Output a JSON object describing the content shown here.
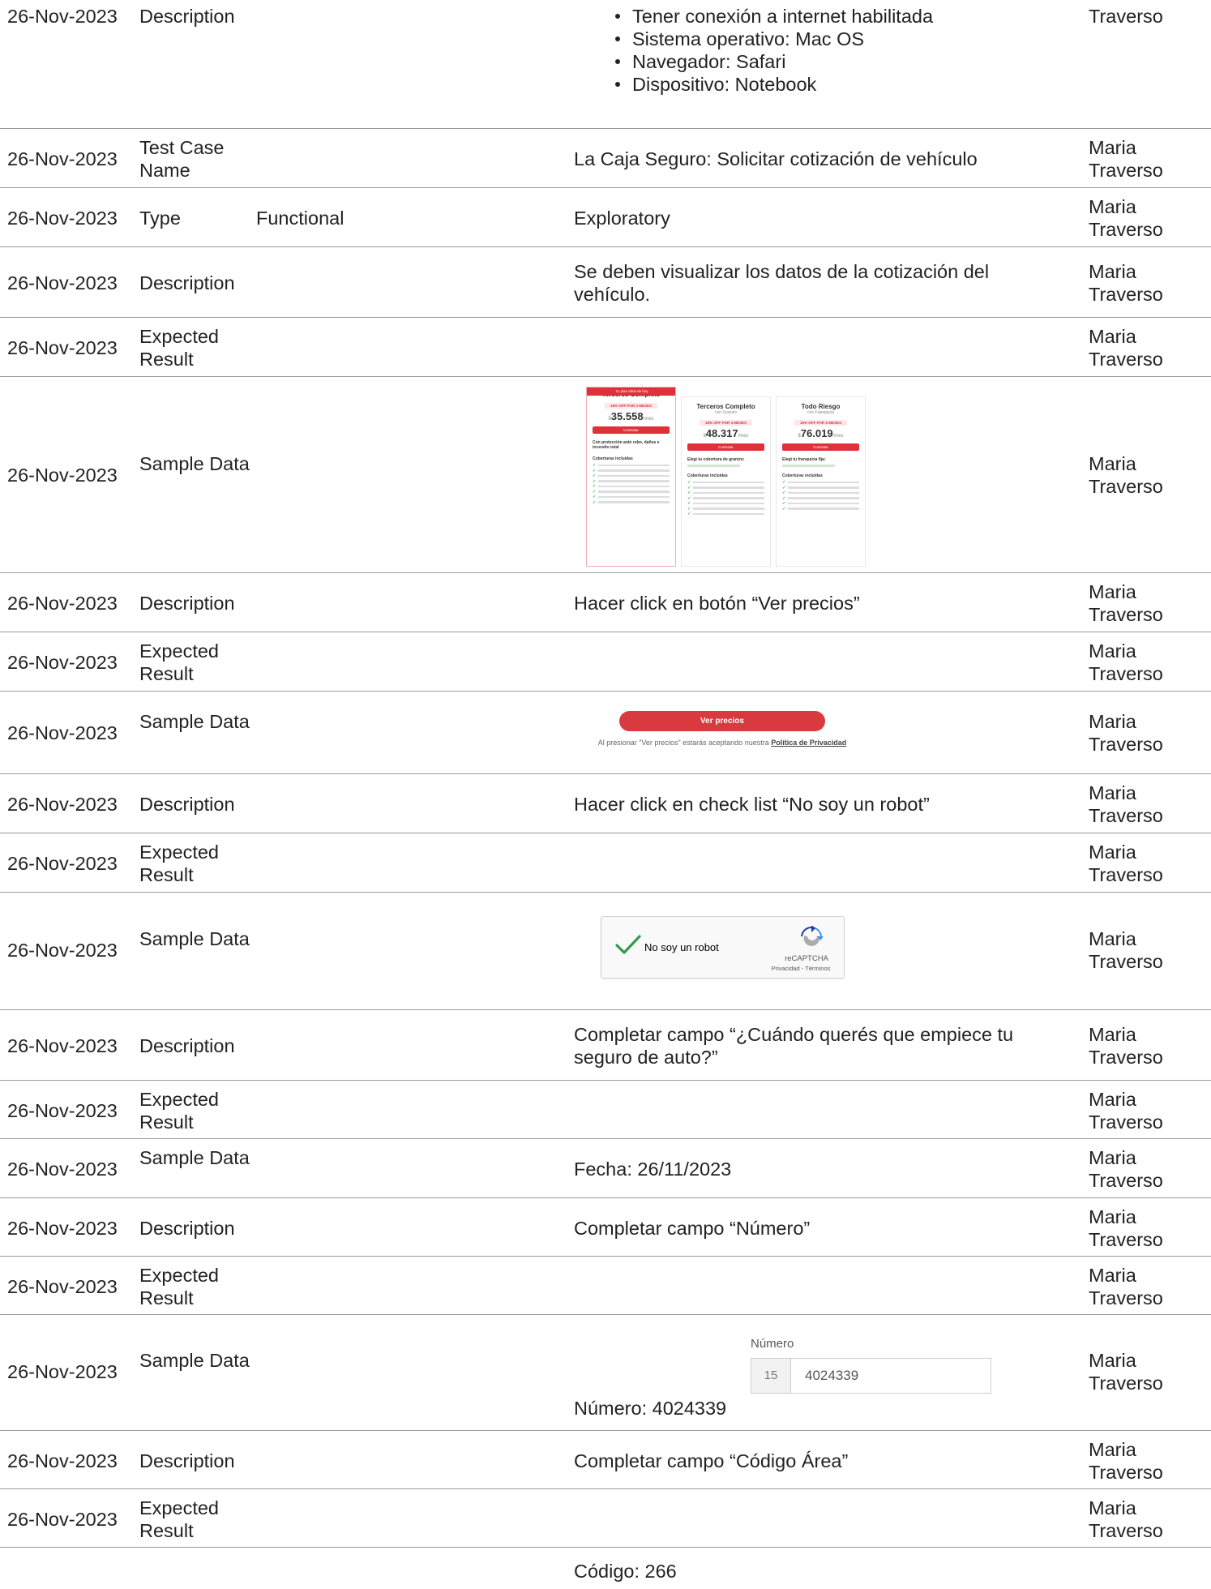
{
  "date": "26-Nov-2023",
  "author": "Maria Traverso",
  "top": {
    "date": "26-Nov-2023",
    "field": "Description",
    "preconditions": [
      "Tener conexión a internet habilitada",
      "Sistema operativo: Mac OS",
      "Navegador: Safari",
      "Dispositivo: Notebook"
    ],
    "author_last": "Traverso"
  },
  "rows": {
    "tc_name": {
      "field": "Test Case Name",
      "main": "La Caja Seguro: Solicitar cotización de vehículo"
    },
    "type": {
      "field": "Type",
      "value": "Functional",
      "main": "Exploratory"
    },
    "desc1": {
      "field": "Description",
      "main": "Se deben visualizar los datos de la cotización del vehículo."
    },
    "exp1": {
      "field": "Expected Result",
      "main": ""
    },
    "sample1": {
      "field": "Sample Data"
    },
    "desc2": {
      "field": "Description",
      "main": "Hacer click en botón “Ver precios”"
    },
    "exp2": {
      "field": "Expected Result",
      "main": ""
    },
    "sample2": {
      "field": "Sample Data"
    },
    "desc3": {
      "field": "Description",
      "main": "Hacer click en check list “No soy un robot”"
    },
    "exp3": {
      "field": "Expected Result",
      "main": ""
    },
    "sample3": {
      "field": "Sample Data"
    },
    "desc4": {
      "field": "Description",
      "main": "Completar campo “¿Cuándo querés que empiece tu seguro de auto?”"
    },
    "exp4": {
      "field": "Expected Result",
      "main": ""
    },
    "sample4": {
      "field": "Sample Data",
      "main": "Fecha: 26/11/2023"
    },
    "desc5": {
      "field": "Description",
      "main": "Completar campo “Número”"
    },
    "exp5": {
      "field": "Expected Result",
      "main": ""
    },
    "sample5": {
      "field": "Sample Data",
      "main": "Número: 4024339"
    },
    "desc6": {
      "field": "Description",
      "main": "Completar campo “Código Área”"
    },
    "exp6": {
      "field": "Expected Result",
      "main": ""
    },
    "bottom": {
      "main": "Código: 266"
    }
  },
  "plans": {
    "banner": "Tu plan ideal de hoy",
    "items": [
      {
        "title": "Terceros Completo",
        "sub": "",
        "off": "15% OFF POR 3 MESES",
        "currency": "$",
        "price": "35.558",
        "per": "/mes",
        "button": "Contratar",
        "note": "Con protección ante robo, daños e incendio total"
      },
      {
        "title": "Terceros Completo",
        "sub": "con Granizo",
        "off": "15% OFF POR 3 MESES",
        "currency": "$",
        "price": "48.317",
        "per": "/mes",
        "button": "Contratar",
        "note": "Elegí tu cobertura de granizo:"
      },
      {
        "title": "Todo Riesgo",
        "sub": "con Franquicia",
        "off": "15% OFF POR 6 MESES",
        "currency": "$",
        "price": "76.019",
        "per": "/mes",
        "button": "Contratar",
        "note": "Elegí tu franquicia fija:"
      }
    ],
    "coverage_header": "Coberturas incluidas"
  },
  "ver_precios": {
    "button": "Ver precios",
    "note_prefix": "Al presionar \"Ver precios\" estarás aceptando nuestra",
    "note_link": "Política de Privacidad"
  },
  "captcha": {
    "label": "No soy un robot",
    "brand": "reCAPTCHA",
    "terms": "Privacidad - Términos"
  },
  "numero": {
    "label": "Número",
    "prefix": "15",
    "value": "4024339"
  }
}
